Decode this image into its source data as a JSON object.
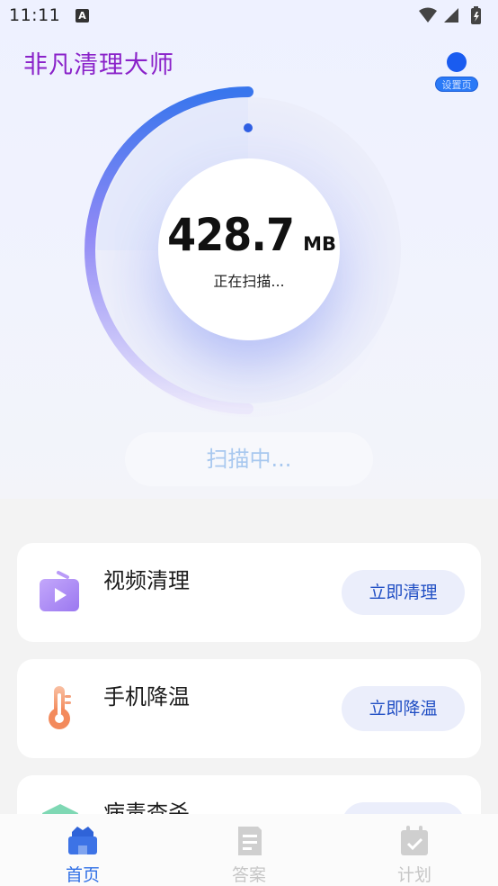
{
  "status_bar": {
    "time": "11:11",
    "indicator": "A"
  },
  "header": {
    "title": "非凡清理大师",
    "settings_label": "设置页",
    "title_color": "#8a22c9",
    "settings_color": "#1a5cf0"
  },
  "scan": {
    "value": "428.7",
    "unit": "MB",
    "status": "正在扫描...",
    "button_label": "扫描中...",
    "progress": 0.25
  },
  "cards": [
    {
      "title": "视频清理",
      "button": "立即清理",
      "icon": "video-icon"
    },
    {
      "title": "手机降温",
      "button": "立即降温",
      "icon": "thermometer-icon"
    },
    {
      "title": "病毒查杀",
      "button": "",
      "icon": "shield-icon"
    }
  ],
  "nav": {
    "items": [
      {
        "label": "首页",
        "icon": "home-icon",
        "active": true
      },
      {
        "label": "答案",
        "icon": "document-icon",
        "active": false
      },
      {
        "label": "计划",
        "icon": "calendar-icon",
        "active": false
      }
    ],
    "active_color": "#2f6fe6",
    "inactive_color": "#c6c6c6"
  }
}
